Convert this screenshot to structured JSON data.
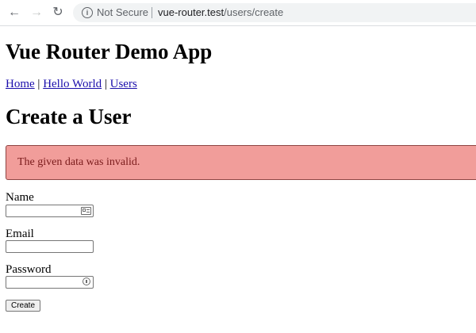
{
  "browser": {
    "security_label": "Not Secure",
    "url_host": "vue-router.test",
    "url_path": "/users/create"
  },
  "page": {
    "app_title": "Vue Router Demo App",
    "nav": [
      {
        "label": "Home"
      },
      {
        "label": "Hello World"
      },
      {
        "label": "Users"
      }
    ],
    "nav_separator": "|",
    "title": "Create a User",
    "alert": "The given data was invalid."
  },
  "form": {
    "name_label": "Name",
    "name_value": "",
    "email_label": "Email",
    "email_value": "",
    "password_label": "Password",
    "password_value": "",
    "submit_label": "Create"
  }
}
